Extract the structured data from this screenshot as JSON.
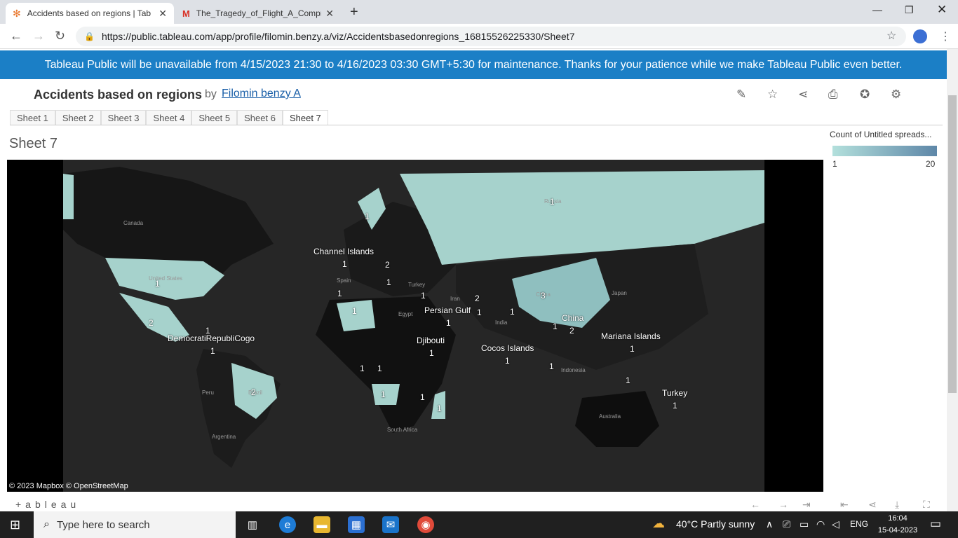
{
  "browser": {
    "tabs": [
      {
        "title": "Accidents based on regions | Tab",
        "icon": "tableau-icon",
        "active": true
      },
      {
        "title": "The_Tragedy_of_Flight_A_Compre",
        "icon": "gmail-icon",
        "active": false
      }
    ],
    "url": "https://public.tableau.com/app/profile/filomin.benzy.a/viz/Accidentsbasedonregions_16815526225330/Sheet7"
  },
  "banner": {
    "text": "Tableau Public will be unavailable from 4/15/2023 21:30 to 4/16/2023 03:30 GMT+5:30 for maintenance. Thanks for your patience while we make Tableau Public even better."
  },
  "viz": {
    "title": "Accidents based on regions",
    "by": "by",
    "author": "Filomin benzy A",
    "sheet_tabs": [
      "Sheet 1",
      "Sheet 2",
      "Sheet 3",
      "Sheet 4",
      "Sheet 5",
      "Sheet 6",
      "Sheet 7"
    ],
    "active_sheet": "Sheet 7",
    "sheet_title": "Sheet 7",
    "legend": {
      "title": "Count of Untitled spreads...",
      "min": "1",
      "max": "20",
      "color_low": "#b3e0dc",
      "color_high": "#5e87a8"
    },
    "attribution": "© 2023 Mapbox © OpenStreetMap",
    "footer_logo": "+ableau"
  },
  "map": {
    "labels": [
      {
        "name": "Channel Islands",
        "value": "1"
      },
      {
        "name": "Persian Gulf",
        "value": "1"
      },
      {
        "name": "China",
        "value": "2"
      },
      {
        "name": "DemocratiRepubliCogo",
        "value": "1"
      },
      {
        "name": "Djibouti",
        "value": "1"
      },
      {
        "name": "Cocos Islands",
        "value": "1"
      },
      {
        "name": "Mariana Islands",
        "value": "1"
      },
      {
        "name": "Turkey",
        "value": "1"
      }
    ],
    "counts": [
      "1",
      "1",
      "2",
      "1",
      "1",
      "1",
      "2",
      "1",
      "1",
      "2",
      "1",
      "3",
      "1",
      "1",
      "1",
      "1",
      "2",
      "1",
      "1",
      "1",
      "1",
      "1",
      "1"
    ],
    "basemap_names": [
      "Canada",
      "United States",
      "Russia",
      "Spain",
      "Turkey",
      "Iran",
      "Egypt",
      "India",
      "China",
      "Japan",
      "Peru",
      "Brazil",
      "Argentina",
      "South Africa",
      "Indonesia",
      "Australia"
    ]
  },
  "taskbar": {
    "search_placeholder": "Type here to search",
    "weather": "40°C  Partly sunny",
    "lang": "ENG",
    "time": "16:04",
    "date": "15-04-2023"
  }
}
